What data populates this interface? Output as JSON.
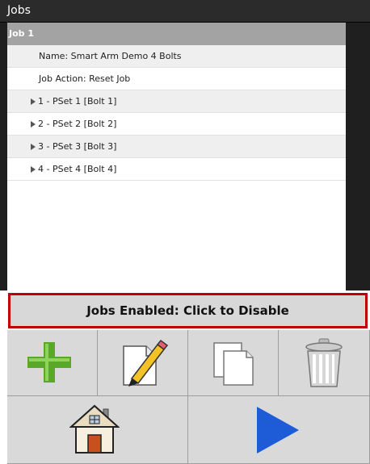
{
  "window": {
    "title": "Jobs"
  },
  "job": {
    "header": "Job 1",
    "name_line": "Name: Smart Arm Demo 4 Bolts",
    "action_line": "Job Action: Reset Job",
    "psets": [
      {
        "label": "1 - PSet 1 [Bolt 1]"
      },
      {
        "label": "2 - PSet 2 [Bolt 2]"
      },
      {
        "label": "3 - PSet 3 [Bolt 3]"
      },
      {
        "label": "4 - PSet 4 [Bolt 4]"
      }
    ]
  },
  "jobs_toggle": {
    "label": "Jobs Enabled: Click to Disable"
  },
  "toolbar": {
    "icons": [
      "plus-icon",
      "pencil-icon",
      "copy-icon",
      "trash-icon",
      "home-icon",
      "play-icon"
    ],
    "colors": {
      "add": "#5aa82a",
      "play": "#1e5bd6",
      "border": "#c00000"
    }
  }
}
